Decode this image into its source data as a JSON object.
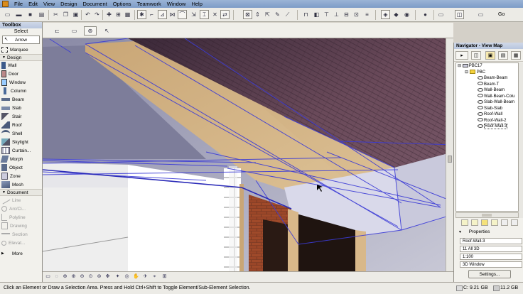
{
  "menu": {
    "items": [
      "File",
      "Edit",
      "View",
      "Design",
      "Document",
      "Options",
      "Teamwork",
      "Window",
      "Help"
    ]
  },
  "toolbar": {
    "go_label": "Go"
  },
  "toolbox": {
    "title": "Toolbox",
    "select_label": "Select",
    "arrow": "Arrow",
    "marquee": "Marquee",
    "design_section": "Design",
    "design_tools": [
      "Wall",
      "Door",
      "Window",
      "Column",
      "Beam",
      "Slab",
      "Stair",
      "Roof",
      "Shell",
      "Skylight",
      "Curtain...",
      "Morph",
      "Object",
      "Zone",
      "Mesh"
    ],
    "document_section": "Document",
    "document_tools": [
      "Line",
      "Arc/Ci...",
      "Polyline",
      "Drawing",
      "Section",
      "Elevat..."
    ],
    "more": "More"
  },
  "navigator": {
    "title": "Navigator - View Map",
    "tree": {
      "root": "PBC17",
      "folder": "PBC",
      "views": [
        "Beam-Beam",
        "Beam-T",
        "Wall-Beam",
        "Wall-Beam-Colu",
        "Slab-Wall-Beam",
        "Slab-Slab",
        "Roof-Wall",
        "Roof-Wall-2",
        "Roof-Wall-3"
      ]
    },
    "properties_label": "Properties",
    "prop_name": "Roof-Wall-3",
    "prop_layer": "11 All 3D",
    "prop_scale": "1:100",
    "prop_window": "3D Window",
    "settings_button": "Settings..."
  },
  "status": {
    "message": "Click an Element or Draw a Selection Area. Press and Hold Ctrl+Shift to Toggle Element/Sub-Element Selection.",
    "disk_c": "C: 9.21 GB",
    "disk_hd": "11.2 GB"
  },
  "colors": {
    "accent": "#3b3bd6",
    "roof": "#5a3a4a",
    "wood": "#d2b48c"
  }
}
